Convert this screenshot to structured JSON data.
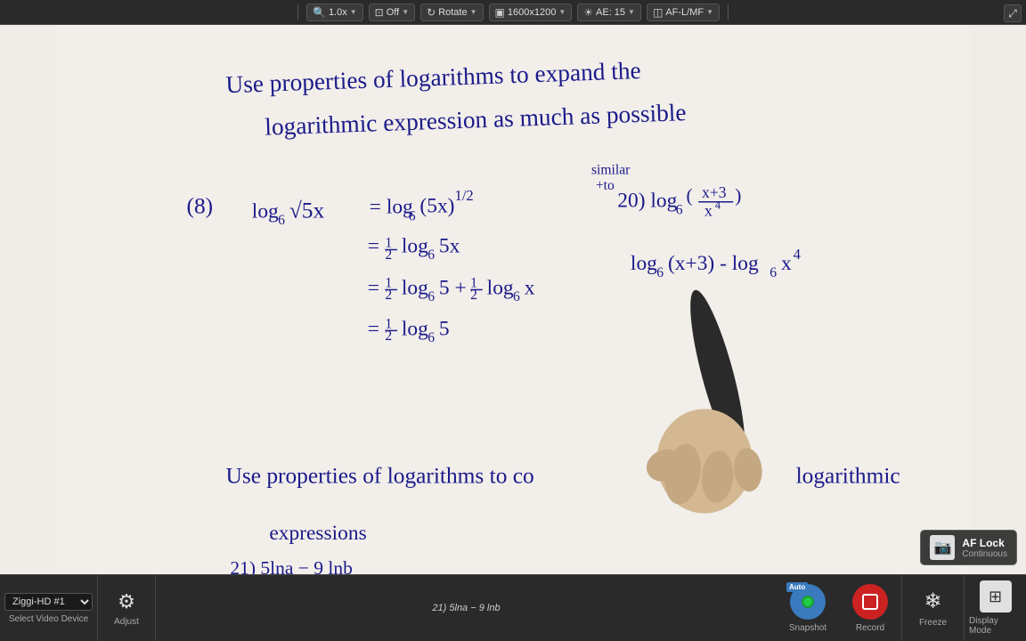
{
  "toolbar": {
    "zoom": "1.0x",
    "overlay": "Off",
    "rotate": "Rotate",
    "resolution": "1600x1200",
    "ae": "AE: 15",
    "af": "AF-L/MF",
    "zoom_label": "1.0x",
    "overlay_label": "Off",
    "rotate_label": "Rotate",
    "resolution_label": "1600x1200",
    "ae_label": "AE: 15",
    "af_label": "AF-L/MF"
  },
  "device": {
    "name": "Ziggi-HD #1",
    "label": "Select Video Device"
  },
  "controls": {
    "adjust": "Adjust",
    "snapshot": "Snapshot",
    "record": "Record",
    "freeze": "Freeze",
    "display_mode": "Display Mode",
    "auto_label": "Auto"
  },
  "af_lock": {
    "title": "AF Lock",
    "subtitle": "Continuous"
  },
  "whiteboard": {
    "line1": "Use properties of logarithms to expand the",
    "line2": "logarithmic expression as much as possible",
    "problem8": "(8)  log₆ √5x  = log₆(5x)^½",
    "step1": "= ½ log₆ 5x",
    "step2": "= ½ log₆ 5 + ½ log₆ x",
    "step3": "= ½ log₆ 5",
    "similar": "similar",
    "to20": "+to",
    "problem20": "20)  log₆ (x+3/x⁴)",
    "result": "log₆(x+3) - log₆ x⁴",
    "bottom_line1": "Use properties of logarithms to co",
    "bottom_line2": "logarithmic",
    "bottom_line3": "expressions",
    "problem21": "21) 5lna - 9 lnb"
  },
  "colors": {
    "background": "#f0ede8",
    "toolbar_bg": "#2a2a2a",
    "bottom_bar_bg": "#2a2a2a",
    "math_ink": "#2a2a9a",
    "record_red": "#cc2222",
    "snapshot_blue": "#3a7abf"
  }
}
